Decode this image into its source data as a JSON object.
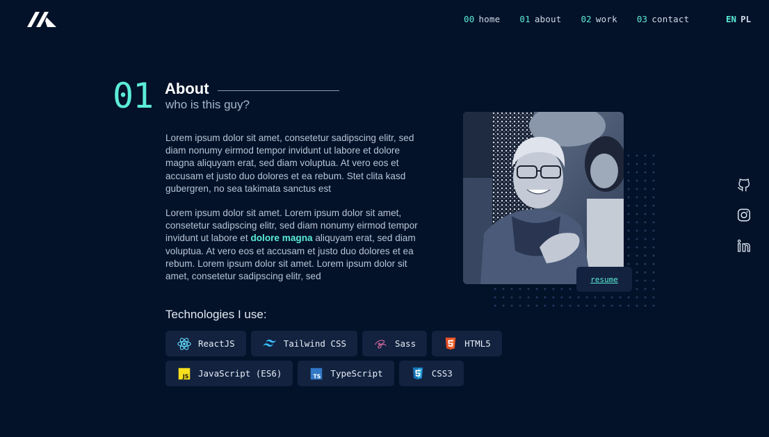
{
  "header": {
    "logo_icon": "brand-logo-icon",
    "nav": [
      {
        "num": "00",
        "label": "home"
      },
      {
        "num": "01",
        "label": "about"
      },
      {
        "num": "02",
        "label": "work"
      },
      {
        "num": "03",
        "label": "contact"
      }
    ],
    "lang": {
      "active": "EN",
      "inactive": "PL"
    }
  },
  "section": {
    "number": "01",
    "title": "About",
    "subtitle": "who is this guy?"
  },
  "paragraphs": {
    "p1": "Lorem ipsum dolor sit amet, consetetur sadipscing elitr, sed diam nonumy eirmod tempor invidunt ut labore et dolore magna aliquyam erat, sed diam voluptua. At vero eos et accusam et justo duo dolores et ea rebum. Stet clita kasd gubergren, no sea takimata sanctus est",
    "p2_before": "Lorem ipsum dolor sit amet. Lorem ipsum dolor sit amet, consetetur sadipscing elitr, sed diam nonumy eirmod tempor invidunt ut labore et ",
    "p2_highlight": "dolore magna",
    "p2_after": " aliquyam erat, sed diam voluptua. At vero eos et accusam et justo duo dolores et ea rebum. Lorem ipsum dolor sit amet. Lorem ipsum dolor sit amet, consetetur sadipscing elitr, sed"
  },
  "technologies": {
    "title": "Technologies I use:",
    "items": [
      {
        "label": "ReactJS",
        "icon": "react-icon"
      },
      {
        "label": "Tailwind CSS",
        "icon": "tailwind-icon"
      },
      {
        "label": "Sass",
        "icon": "sass-icon"
      },
      {
        "label": "HTML5",
        "icon": "html5-icon"
      },
      {
        "label": "JavaScript (ES6)",
        "icon": "javascript-icon"
      },
      {
        "label": "TypeScript",
        "icon": "typescript-icon"
      },
      {
        "label": "CSS3",
        "icon": "css3-icon"
      }
    ]
  },
  "photo": {
    "resume_label": "resume"
  },
  "socials": [
    {
      "icon": "github-icon"
    },
    {
      "icon": "instagram-icon"
    },
    {
      "icon": "linkedin-icon"
    }
  ],
  "colors": {
    "background": "#031229",
    "accent": "#5cecd6",
    "chip": "#12223f"
  }
}
